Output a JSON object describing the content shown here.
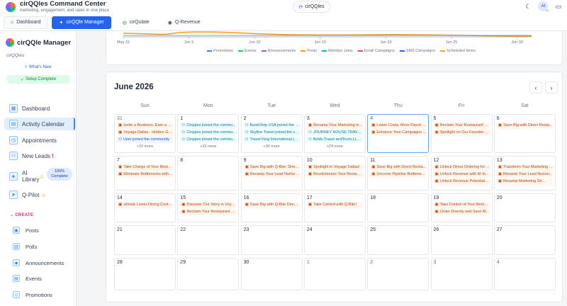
{
  "app": {
    "title": "cirQQles Command Center",
    "subtitle": "marketing, engagement, and sales in one place",
    "brand_pill": "cirQQles",
    "avatar": "AI"
  },
  "tabs": [
    {
      "label": "Dashboard",
      "icon": "⌂",
      "active": false
    },
    {
      "label": "cirQQle Manager",
      "icon": "✦",
      "active": true
    },
    {
      "label": "cirQulate",
      "icon": "◎",
      "active": false
    },
    {
      "label": "Q-Revenue",
      "icon": "◉",
      "active": false
    }
  ],
  "sidebar": {
    "title": "cirQQle Manager",
    "subtitle": "cirQQles",
    "whats_new": "What's New",
    "setup": "Setup Complete",
    "nav": [
      {
        "label": "Dashboard",
        "icon": "▦"
      },
      {
        "label": "Activity Calendar",
        "icon": "▤"
      },
      {
        "label": "Appointments",
        "icon": "◷"
      },
      {
        "label": "New Leads",
        "icon": "⚇"
      },
      {
        "label": "AI Library",
        "icon": "◈"
      },
      {
        "label": "Q-Pilot",
        "icon": "➤"
      }
    ],
    "ai_badge": "100% Complete",
    "create_label": "CREATE",
    "create_items": [
      {
        "label": "Posts",
        "icon": "▣"
      },
      {
        "label": "Polls",
        "icon": "▥"
      },
      {
        "label": "Announcements",
        "icon": "◆"
      },
      {
        "label": "Events",
        "icon": "▤"
      },
      {
        "label": "Promotions",
        "icon": "◇"
      }
    ]
  },
  "chart_data": {
    "type": "line",
    "x_ticks": [
      "May 31",
      "Jun 5",
      "Jun 10",
      "Jun 15",
      "Jun 20",
      "Jun 25",
      "Jun 30"
    ],
    "series": [
      {
        "name": "Promotions",
        "color": "#3b82f6"
      },
      {
        "name": "Events",
        "color": "#22c55e"
      },
      {
        "name": "Announcements",
        "color": "#a855f7"
      },
      {
        "name": "Posts",
        "color": "#f59e0b"
      },
      {
        "name": "Member Joins",
        "color": "#06b6d4"
      },
      {
        "name": "Email Campaigns",
        "color": "#ef4444"
      },
      {
        "name": "SMS Campaigns",
        "color": "#2563eb"
      },
      {
        "name": "Scheduled Items",
        "color": "#eab308"
      }
    ]
  },
  "calendar": {
    "title": "June 2026",
    "prev": "‹",
    "next": "›",
    "days": [
      "Sun",
      "Mon",
      "Tue",
      "Wed",
      "Thu",
      "Fri",
      "Sat"
    ],
    "weeks": [
      [
        {
          "d": "31",
          "other": true,
          "events": [
            [
              "orange",
              "▣",
              "Invite a Business, Earn a $..."
            ],
            [
              "orange",
              "▣",
              "Voyage Dallas - Hidden Ge..."
            ],
            [
              "blue",
              "⚇",
              "User joined the community"
            ]
          ],
          "more": "+32 more"
        },
        {
          "d": "1",
          "events": [
            [
              "cyan",
              "⚇",
              "Cirqqles joined the commu..."
            ],
            [
              "cyan",
              "⚇",
              "Cirqqles joined the commu..."
            ],
            [
              "cyan",
              "⚇",
              "Cirqqles joined the commu..."
            ]
          ],
          "more": "+33 more"
        },
        {
          "d": "2",
          "events": [
            [
              "cyan",
              "⚇",
              "BookOtrip USA joined the c..."
            ],
            [
              "cyan",
              "⚇",
              "Skyline Travel joined the c..."
            ],
            [
              "cyan",
              "⚇",
              "Travel King International joi..."
            ]
          ],
          "more": "+30 more"
        },
        {
          "d": "3",
          "events": [
            [
              "orange",
              "▣",
              "Revamp Your Marketing wit..."
            ],
            [
              "cyan",
              "⚇",
              "JOURNEY HOUSE TRAVEL I..."
            ],
            [
              "cyan",
              "⚇",
              "Bolds Travel andTours,LLC ..."
            ]
          ],
          "more": "+29 more"
        },
        {
          "d": "4",
          "today": true,
          "events": [
            [
              "orange",
              "▣",
              "Lower Costs, More Flavor ..."
            ],
            [
              "orange",
              "▣",
              "Enhance Your Campaigns ..."
            ]
          ]
        },
        {
          "d": "5",
          "events": [
            [
              "orange",
              "▣",
              "Reclaim Your Restaurant's ..."
            ],
            [
              "orange",
              "▣",
              "Spotlight on Our Founder in..."
            ]
          ]
        },
        {
          "d": "6",
          "events": [
            [
              "orange",
              "▣",
              "Save Big with Direct Resta..."
            ]
          ]
        }
      ],
      [
        {
          "d": "7",
          "events": [
            [
              "orange",
              "▣",
              "Take Charge of Your Resta..."
            ],
            [
              "orange",
              "▣",
              "Eliminate Bottlenecks with ..."
            ]
          ]
        },
        {
          "d": "8",
          "events": []
        },
        {
          "d": "9",
          "events": [
            [
              "orange",
              "▣",
              "Save Big with Q-Bite: Direct..."
            ],
            [
              "orange",
              "▣",
              "Revamp Your Lead Nurturin..."
            ]
          ]
        },
        {
          "d": "10",
          "events": [
            [
              "orange",
              "▣",
              "Spotlight in Voyage Dallas!"
            ],
            [
              "orange",
              "▣",
              "Revolutionize Your Restaur..."
            ]
          ]
        },
        {
          "d": "11",
          "events": [
            [
              "orange",
              "▣",
              "Save Big with Direct Resta..."
            ],
            [
              "orange",
              "▣",
              "Uncover Pipeline Bottlenec..."
            ]
          ]
        },
        {
          "d": "12",
          "events": [
            [
              "orange",
              "▣",
              "Unlock Direct Ordering for ..."
            ],
            [
              "orange",
              "▣",
              "Unlock Revenue with AI In..."
            ],
            [
              "orange",
              "▣",
              "Unlock Revenue Potential w..."
            ]
          ]
        },
        {
          "d": "13",
          "events": [
            [
              "orange",
              "▣",
              "Transform Your Marketing ..."
            ],
            [
              "orange",
              "▣",
              "Revamp Your Lead Nurturi..."
            ],
            [
              "orange",
              "▣",
              "Revamp Marketing Str..."
            ]
          ]
        }
      ],
      [
        {
          "d": "14",
          "events": [
            [
              "orange",
              "▣",
              "Unlock Lower Dining Costs..."
            ]
          ]
        },
        {
          "d": "15",
          "events": [
            [
              "orange",
              "▣",
              "Discover Our Story in Voya..."
            ],
            [
              "orange",
              "▣",
              "Reclaim Your Restaurant Pr..."
            ]
          ]
        },
        {
          "d": "16",
          "events": [
            [
              "orange",
              "▣",
              "Save Big with Q-Bite Direct..."
            ]
          ]
        },
        {
          "d": "17",
          "events": [
            [
              "orange",
              "▣",
              "Take Control with Q-Bite!"
            ]
          ]
        },
        {
          "d": "18",
          "events": []
        },
        {
          "d": "19",
          "events": [
            [
              "orange",
              "▣",
              "Take Control of Your Resta..."
            ],
            [
              "orange",
              "▣",
              "Order Directly and Save M..."
            ]
          ]
        },
        {
          "d": "20",
          "events": []
        }
      ],
      [
        {
          "d": "21",
          "events": []
        },
        {
          "d": "22",
          "events": []
        },
        {
          "d": "23",
          "events": []
        },
        {
          "d": "24",
          "events": []
        },
        {
          "d": "25",
          "events": []
        },
        {
          "d": "26",
          "events": []
        },
        {
          "d": "27",
          "events": []
        }
      ],
      [
        {
          "d": "28",
          "events": []
        },
        {
          "d": "29",
          "events": []
        },
        {
          "d": "30",
          "events": []
        },
        {
          "d": "1",
          "other": true,
          "events": []
        },
        {
          "d": "2",
          "other": true,
          "events": []
        },
        {
          "d": "3",
          "other": true,
          "events": []
        },
        {
          "d": "4",
          "other": true,
          "events": []
        }
      ]
    ]
  }
}
